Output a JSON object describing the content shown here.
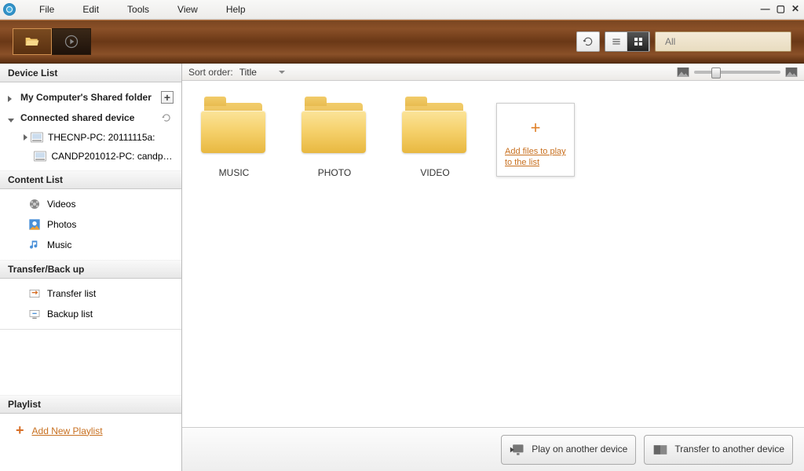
{
  "menu": {
    "file": "File",
    "edit": "Edit",
    "tools": "Tools",
    "view": "View",
    "help": "Help"
  },
  "search": {
    "placeholder": "All"
  },
  "sidebar": {
    "device_list_header": "Device List",
    "my_computer": "My Computer's Shared folder",
    "connected_header": "Connected shared device",
    "devices": [
      {
        "label": "THECNP-PC: 20111115a:"
      },
      {
        "label": "CANDP201012-PC: candp 2..."
      }
    ],
    "content_list_header": "Content List",
    "content_items": {
      "videos": "Videos",
      "photos": "Photos",
      "music": "Music"
    },
    "transfer_header": "Transfer/Back up",
    "transfer_items": {
      "transfer": "Transfer list",
      "backup": "Backup list"
    },
    "playlist_header": "Playlist",
    "add_playlist": "Add New Playlist"
  },
  "sortbar": {
    "label": "Sort order:",
    "value": "Title"
  },
  "folders": {
    "music": "MUSIC",
    "photo": "PHOTO",
    "video": "VIDEO"
  },
  "add_tile": "Add files to play to the list",
  "footer": {
    "play": "Play on another device",
    "transfer": "Transfer to another device"
  }
}
